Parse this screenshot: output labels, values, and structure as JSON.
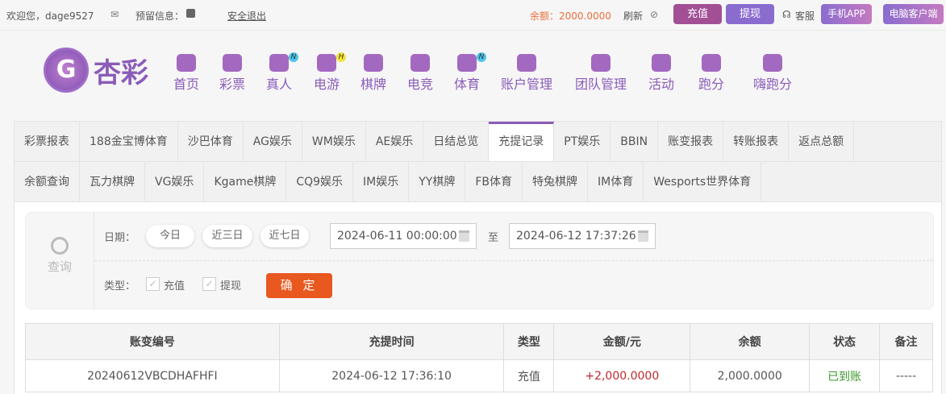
{
  "topbar": {
    "welcome": "欢迎您，dage9527",
    "reserved_info": "预留信息：",
    "logout": "安全退出",
    "balance": "余额：2000.0000",
    "refresh": "刷新",
    "recharge": "充值",
    "withdraw": "提现",
    "service": "客服",
    "mobile_app": "手机APP",
    "pc_client": "电脑客户端"
  },
  "nav": {
    "logo": "杏彩",
    "items": [
      {
        "label": "首页",
        "icon": "home-icon"
      },
      {
        "label": "彩票",
        "icon": "ticket-icon"
      },
      {
        "label": "真人",
        "icon": "live-dealer-icon",
        "badge": "N"
      },
      {
        "label": "电游",
        "icon": "gamepad-icon",
        "badge": "H"
      },
      {
        "label": "棋牌",
        "icon": "cards-icon"
      },
      {
        "label": "电竞",
        "icon": "gamepad-icon"
      },
      {
        "label": "体育",
        "icon": "trophy-icon",
        "badge": "N"
      },
      {
        "label": "账户管理",
        "icon": "yen-icon"
      },
      {
        "label": "团队管理",
        "icon": "team-icon"
      },
      {
        "label": "活动",
        "icon": "gift-icon"
      },
      {
        "label": "跑分",
        "icon": "rhino-icon"
      },
      {
        "label": "嗨跑分",
        "icon": "hi-icon"
      }
    ]
  },
  "tabs": {
    "row1": [
      "彩票报表",
      "188金宝博体育",
      "沙巴体育",
      "AG娱乐",
      "WM娱乐",
      "AE娱乐",
      "日结总览",
      "充提记录",
      "PT娱乐",
      "BBIN",
      "账变报表",
      "转账报表",
      "返点总额"
    ],
    "row2": [
      "余额查询",
      "瓦力棋牌",
      "VG娱乐",
      "Kgame棋牌",
      "CQ9娱乐",
      "IM娱乐",
      "YY棋牌",
      "FB体育",
      "特兔棋牌",
      "IM体育",
      "Wesports世界体育"
    ],
    "active": "充提记录"
  },
  "query": {
    "icon_label": "查询",
    "date_label": "日期：",
    "today": "今日",
    "last3": "近三日",
    "last7": "近七日",
    "start": "2024-06-11 00:00:00",
    "to": "至",
    "end": "2024-06-12 17:37:26",
    "type_label": "类型：",
    "type_recharge": "充值",
    "type_withdraw": "提现",
    "confirm": "确 定"
  },
  "table": {
    "headers": [
      "账变编号",
      "充提时间",
      "类型",
      "金额/元",
      "余额",
      "状态",
      "备注"
    ],
    "rows": [
      [
        "20240612VBCDHAFHFI",
        "2024-06-12 17:36:10",
        "充值",
        "+2,000.0000",
        "2,000.0000",
        "已到账",
        "-----"
      ]
    ]
  },
  "colors": {
    "accent": "#8a5cb8",
    "confirm": "#e8581f",
    "amount": "#c0282d",
    "status_ok": "#3a9a2a",
    "balance": "#e8703a"
  }
}
